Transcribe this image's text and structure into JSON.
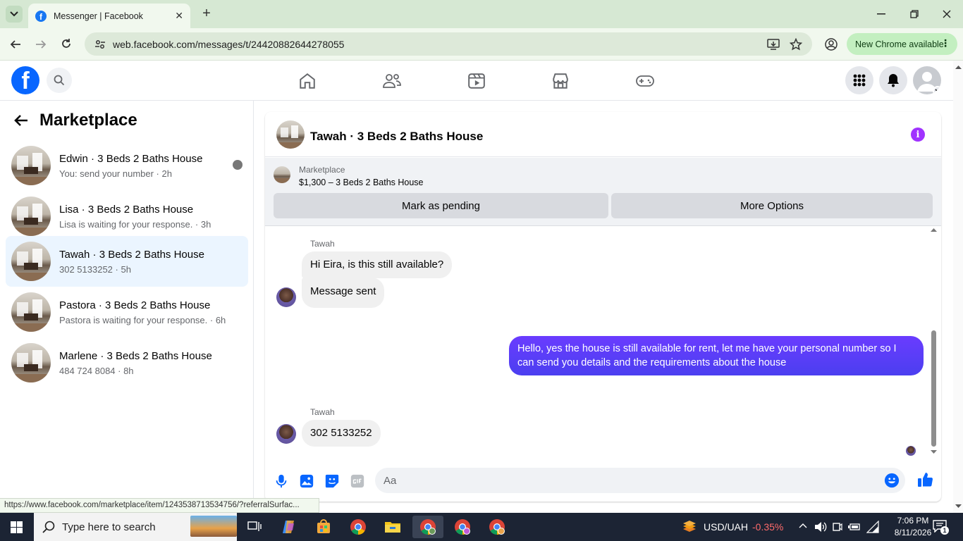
{
  "browser": {
    "tab_title": "Messenger | Facebook",
    "url": "web.facebook.com/messages/t/24420882644278055",
    "update_label": "New Chrome available",
    "status_url": "https://www.facebook.com/marketplace/item/1243538713534756/?referralSurfac..."
  },
  "sidebar": {
    "title": "Marketplace",
    "conversations": [
      {
        "name": "Edwin · 3 Beds 2 Baths House",
        "preview": "You: send your number · 2h"
      },
      {
        "name": "Lisa · 3 Beds 2 Baths House",
        "preview": "Lisa is waiting for your response. · 3h"
      },
      {
        "name": "Tawah · 3 Beds 2 Baths House",
        "preview": "302 5133252 · 5h"
      },
      {
        "name": "Pastora · 3 Beds 2 Baths House",
        "preview": "Pastora is waiting for your response. · 6h"
      },
      {
        "name": "Marlene · 3 Beds 2 Baths House",
        "preview": "484 724 8084 · 8h"
      }
    ]
  },
  "chat": {
    "title": "Tawah · 3 Beds 2 Baths House",
    "listing_source": "Marketplace",
    "listing_title": "$1,300 – 3 Beds 2 Baths House",
    "mark_pending_label": "Mark as pending",
    "more_options_label": "More Options",
    "messages": [
      {
        "sender": "Tawah",
        "text": "Hi Eira, is this still available?"
      },
      {
        "text": "Message sent"
      },
      {
        "text": "Hello, yes the house is still available for rent, let me have your personal number so I can send you details and the requirements about the house"
      },
      {
        "sender": "Tawah",
        "text": "302 5133252"
      }
    ],
    "composer_placeholder": "Aa"
  },
  "taskbar": {
    "search_placeholder": "Type here to search",
    "ticker": "USD/UAH",
    "ticker_change": "-0.35%",
    "time": "7:06 PM",
    "date": "8/11/2026",
    "notification_count": "1"
  },
  "colors": {
    "fb_blue": "#0866ff",
    "messenger_purple": "#5b3bff",
    "info_purple": "#a033ff",
    "active_row": "#ebf5ff",
    "ticker_red": "#ff6b6b"
  }
}
